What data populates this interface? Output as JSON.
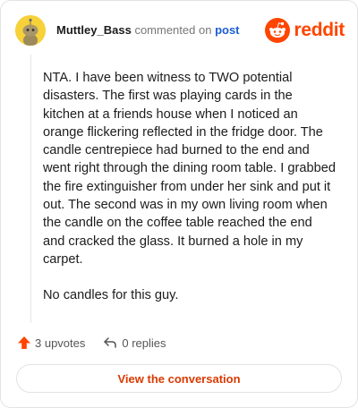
{
  "header": {
    "username": "Muttley_Bass",
    "action_text": "commented on",
    "post_link": "post",
    "brand_name": "reddit",
    "avatar_icon": "snoo-avatar-icon",
    "brand_icon": "reddit-alien-icon"
  },
  "comment": {
    "paragraphs": [
      "NTA. I have been witness to TWO potential disasters. The first was playing cards in the kitchen at a friends house when I noticed an orange flickering reflected in the fridge door. The candle centrepiece had burned to the end and went right through the dining room table. I grabbed the fire extinguisher from under her sink and put it out. The second was in my own living room when the candle on the coffee table reached the end and cracked the glass. It burned a hole in my carpet.",
      "No candles for this guy."
    ]
  },
  "stats": {
    "upvotes": "3 upvotes",
    "replies": "0 replies",
    "upvote_icon": "upvote-arrow-icon",
    "reply_icon": "reply-arrow-icon"
  },
  "cta": {
    "label": "View the conversation"
  },
  "colors": {
    "brand": "#ff4500",
    "cta_text": "#d93a00",
    "link": "#1c5fd1",
    "avatar_bg": "#f7d13a"
  }
}
